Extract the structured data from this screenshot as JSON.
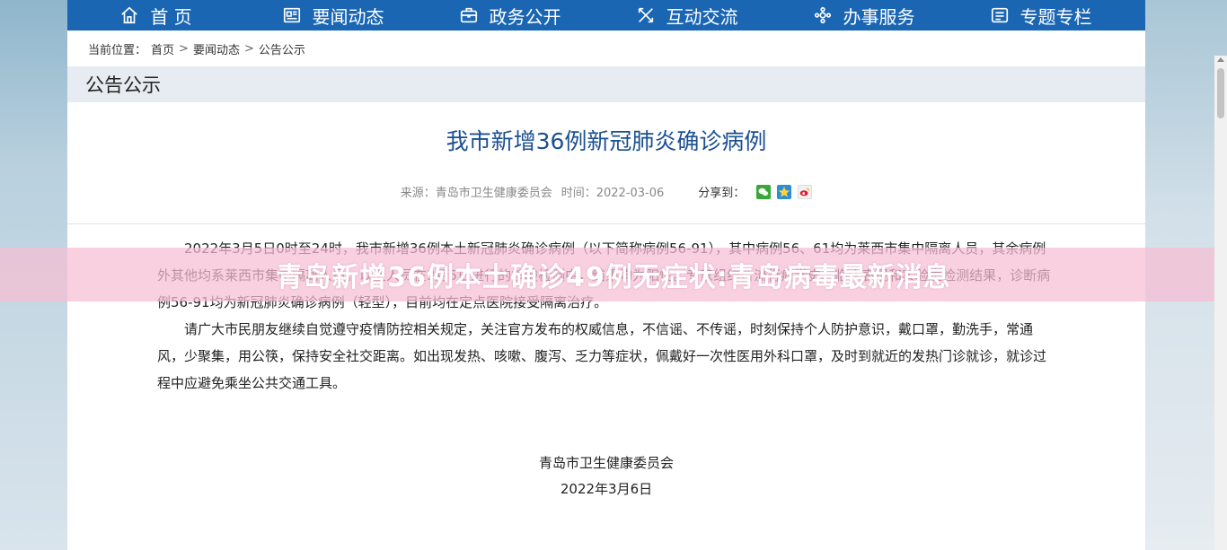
{
  "nav": {
    "items": [
      {
        "label": "首 页",
        "icon": "home-icon"
      },
      {
        "label": "要闻动态",
        "icon": "news-icon"
      },
      {
        "label": "政务公开",
        "icon": "briefcase-icon"
      },
      {
        "label": "互动交流",
        "icon": "interact-icon"
      },
      {
        "label": "办事服务",
        "icon": "service-icon"
      },
      {
        "label": "专题专栏",
        "icon": "topic-icon"
      }
    ]
  },
  "breadcrumb": {
    "prefix": "当前位置：",
    "items": [
      "首页",
      "要闻动态",
      "公告公示"
    ],
    "separator": ">"
  },
  "section": {
    "title": "公告公示"
  },
  "article": {
    "title": "我市新增36例新冠肺炎确诊病例",
    "source": "来源：青岛市卫生健康委员会",
    "time": "时间：2022-03-06",
    "share_label": "分享到：",
    "share_icons": [
      "wechat-icon",
      "qzone-icon",
      "weibo-icon"
    ],
    "paragraphs": [
      "2022年3月5日0时至24时，我市新增36例本土新冠肺炎确诊病例（以下简称病例56-91），其中病例56、61均为莱西市集中隔离人员，其余病例外其他均系莱西市集中隔离人员。以上人员在3月5日进行的核酸检测中，结果均为阳性。专家组结合流行病学史、临床表现和实验室检测结果，诊断病例56-91均为新冠肺炎确诊病例（轻型），目前均在定点医院接受隔离治疗。",
      "请广大市民朋友继续自觉遵守疫情防控相关规定，关注官方发布的权威信息，不信谣、不传谣，时刻保持个人防护意识，戴口罩，勤洗手，常通风，少聚集，用公筷，保持安全社交距离。如出现发热、咳嗽、腹泻、乏力等症状，佩戴好一次性医用外科口罩，及时到就近的发热门诊就诊，就诊过程中应避免乘坐公共交通工具。"
    ],
    "signoff_org": "青岛市卫生健康委员会",
    "signoff_date": "2022年3月6日"
  },
  "overlay": {
    "text": "青岛新增36例本土确诊49例无症状:青岛病毒最新消息"
  },
  "colors": {
    "nav_bg": "#1a66b3",
    "title_blue": "#1b4f91",
    "section_bg": "#e7ecf2",
    "overlay_pink": "#f7bed2"
  }
}
